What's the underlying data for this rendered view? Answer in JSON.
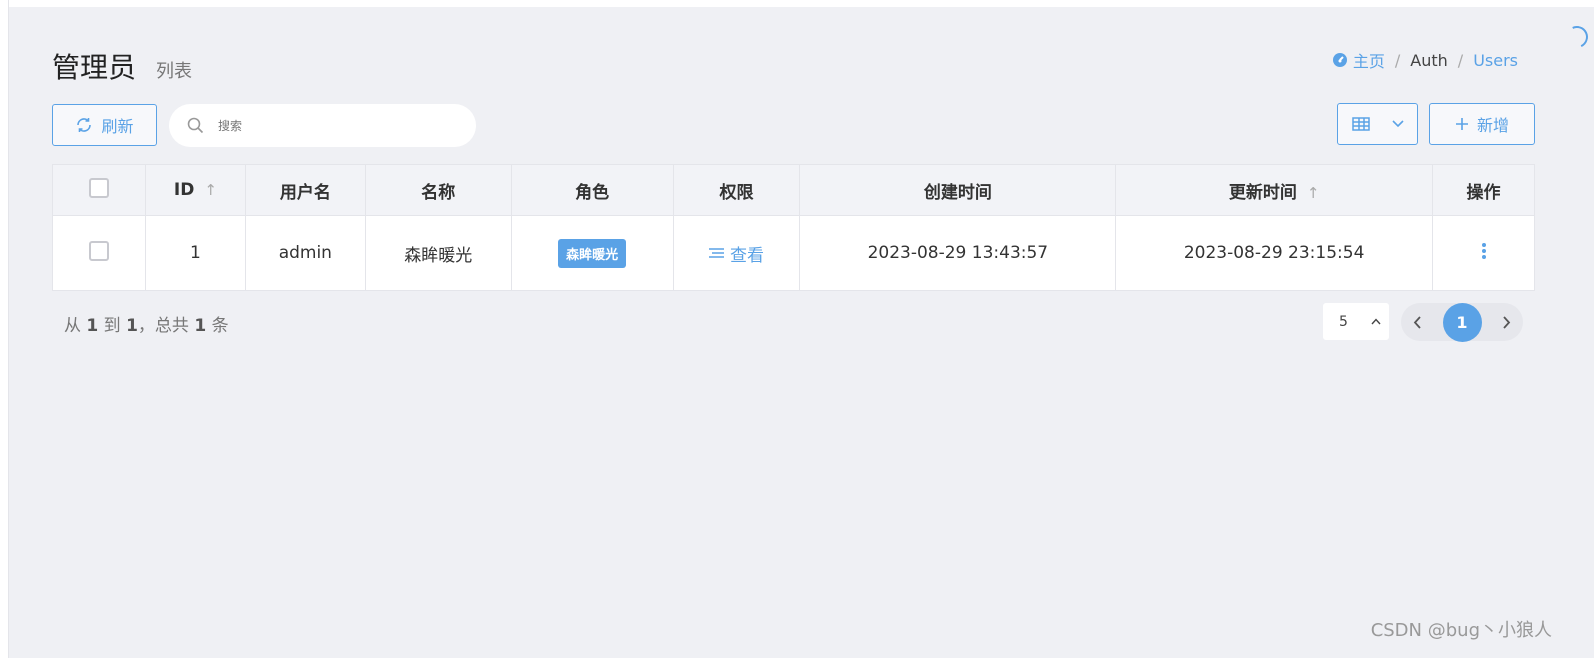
{
  "header": {
    "title": "管理员",
    "subtitle": "列表"
  },
  "breadcrumb": {
    "home": "主页",
    "section": "Auth",
    "current": "Users",
    "sep": "/"
  },
  "toolbar": {
    "refresh_label": "刷新",
    "search_placeholder": "搜索",
    "add_label": "新增"
  },
  "table": {
    "columns": {
      "id": "ID",
      "username": "用户名",
      "name": "名称",
      "role": "角色",
      "permission": "权限",
      "created": "创建时间",
      "updated": "更新时间",
      "actions": "操作"
    },
    "rows": [
      {
        "id": "1",
        "username": "admin",
        "name": "森眸暖光",
        "role": "森眸暖光",
        "permission": "查看",
        "created": "2023-08-29 13:43:57",
        "updated": "2023-08-29 23:15:54"
      }
    ]
  },
  "pagination": {
    "summary_from_label": "从",
    "from": "1",
    "summary_to_label": "到",
    "to": "1",
    "summary_total_label": "，总共",
    "total": "1",
    "summary_unit": "条",
    "per_page": "5",
    "current_page": "1"
  },
  "watermark": "CSDN @bug丶小狼人",
  "colors": {
    "accent": "#5aa2e6",
    "background": "#eff0f4"
  }
}
